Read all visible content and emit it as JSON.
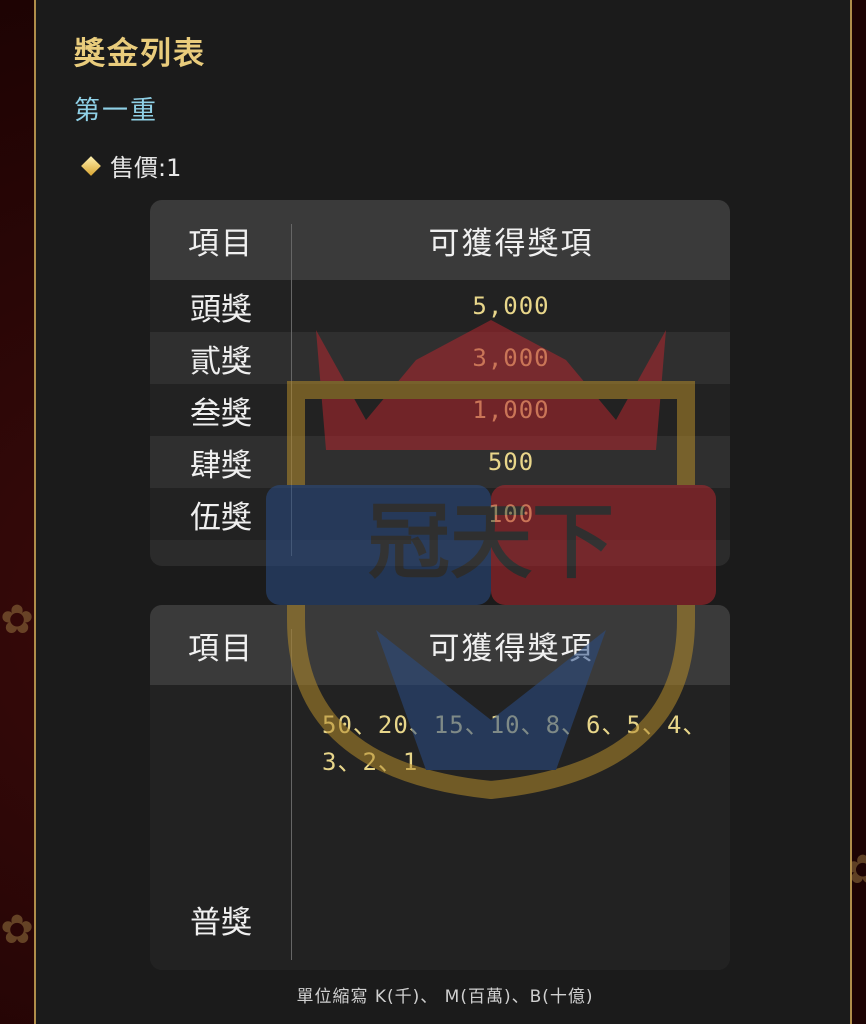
{
  "header": {
    "title": "獎金列表",
    "subtitle": "第一重",
    "price_label": "售價:1"
  },
  "table1": {
    "col_item": "項目",
    "col_prize": "可獲得獎項",
    "rows": [
      {
        "item": "頭獎",
        "value": "5,000"
      },
      {
        "item": "貳獎",
        "value": "3,000"
      },
      {
        "item": "叁獎",
        "value": "1,000"
      },
      {
        "item": "肆獎",
        "value": "500"
      },
      {
        "item": "伍獎",
        "value": "100"
      }
    ]
  },
  "table2": {
    "col_item": "項目",
    "col_prize": "可獲得獎項",
    "item": "普獎",
    "values": "50、20、15、10、8、6、5、4、3、2、1"
  },
  "footnote": "單位縮寫 K(千)、 M(百萬)、B(十億)",
  "watermark": {
    "text": "冠天下",
    "colors": {
      "red": "#b3262e",
      "blue": "#2a4d86",
      "gold": "#b38a2a"
    }
  }
}
